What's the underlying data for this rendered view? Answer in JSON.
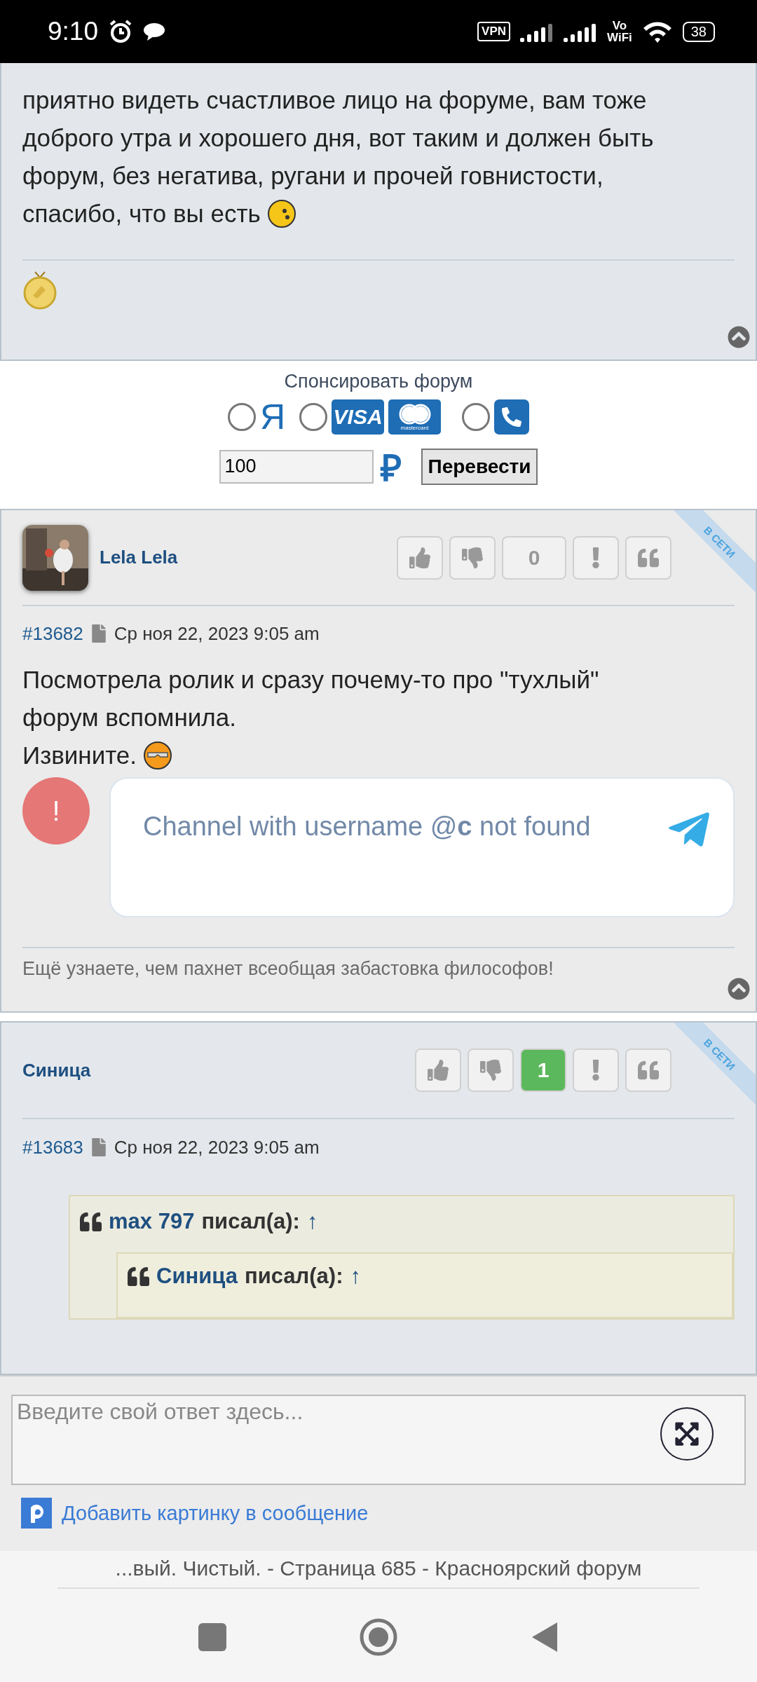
{
  "status_bar": {
    "time": "9:10",
    "vpn": "VPN",
    "volte_top": "Vo",
    "volte_bottom": "WiFi",
    "battery": "38"
  },
  "previous_post": {
    "lines": [
      "приятно видеть счастливое лицо на форуме, вам тоже",
      "доброго утра и хорошего дня, вот таким и должен быть",
      "форум, без негатива, ругани и прочей говнистости,",
      "спасибо, что вы есть"
    ],
    "smiley": true
  },
  "sponsor": {
    "title": "Спонсировать форум",
    "methods": [
      {
        "kind": "yandex",
        "logo": "Я",
        "selected": false
      },
      {
        "kind": "cards",
        "visa": "VISA",
        "mastercard": "mastercard",
        "selected": false
      },
      {
        "kind": "phone",
        "selected": false
      }
    ],
    "amount": "100",
    "currency": "₽",
    "button": "Перевести"
  },
  "posts": [
    {
      "author": "Lela Lela",
      "avatar": {
        "kind": "picture"
      },
      "ribbon": "В СЕТИ",
      "rating": "0",
      "rating_positive": false,
      "number": "#13682",
      "date": "Ср ноя 22, 2023 9:05 am",
      "lines": [
        "Посмотрела ролик и сразу почему-то про \"тухлый\"",
        "форум вспомнила.",
        "Извините."
      ],
      "smiley": true,
      "embed": {
        "alert": "!",
        "message": "Channel with username @**c** not found"
      },
      "signature": "Ещё узнаете, чем пахнет всеобщая забастовка философов!"
    },
    {
      "author": "Синица",
      "ribbon": "В СЕТИ",
      "rating": "1",
      "rating_positive": true,
      "number": "#13683",
      "date": "Ср ноя 22, 2023 9:05 am",
      "quote": {
        "author": "max 797",
        "wrote": "писал(а):",
        "arrow": "↑",
        "nested": {
          "author": "Синица",
          "wrote": "писал(а):",
          "arrow": "↑"
        }
      }
    }
  ],
  "reply": {
    "placeholder": "Введите свой ответ здесь...",
    "add_image": "Добавить картинку в сообщение"
  },
  "browser": {
    "page_title": "...вый. Чистый. - Страница 685 - Красноярский форум"
  }
}
